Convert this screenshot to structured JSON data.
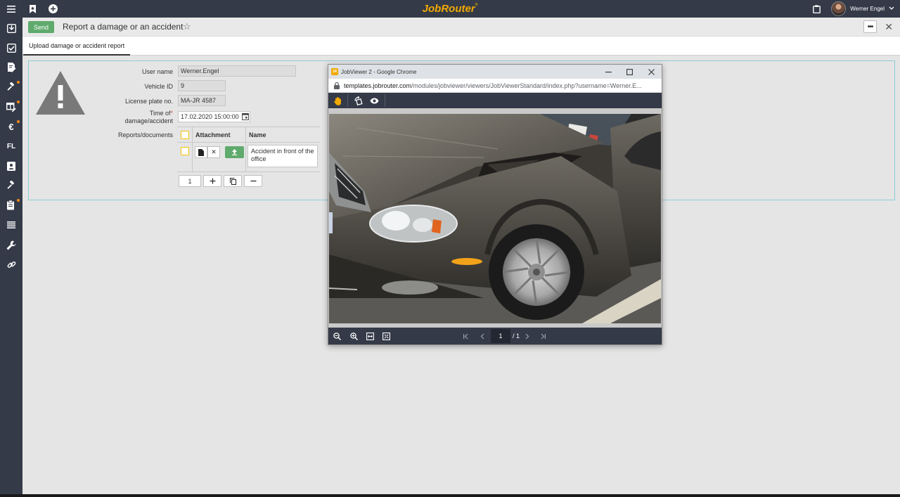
{
  "app": {
    "brand": "JobRouter",
    "brand_mark": "®"
  },
  "topbar": {
    "user_name": "Werner Engel"
  },
  "sidebar": {
    "items": [
      {
        "icon": "inbox-icon"
      },
      {
        "icon": "checkbox-icon"
      },
      {
        "icon": "document-edit-icon"
      },
      {
        "icon": "gavel-icon"
      },
      {
        "icon": "table-edit-icon"
      },
      {
        "icon": "euro-icon"
      },
      {
        "icon": "fl-text-icon",
        "text": "FL"
      },
      {
        "icon": "contact-card-icon"
      },
      {
        "icon": "gavel-icon"
      },
      {
        "icon": "clipboard-icon"
      },
      {
        "icon": "list-icon"
      },
      {
        "icon": "wrench-icon"
      },
      {
        "icon": "link-icon"
      }
    ]
  },
  "header": {
    "send_label": "Send",
    "title": "Report a damage or an accident",
    "more_label": "•••"
  },
  "tabs": [
    {
      "label": "Upload damage or accident report"
    }
  ],
  "form": {
    "user_name_label": "User name",
    "user_name_value": "Werner.Engel",
    "vehicle_id_label": "Vehicle ID",
    "vehicle_id_value": "9",
    "license_plate_label": "License plate no.",
    "license_plate_value": "MA-JR 4587",
    "time_label_line1": "Time of",
    "time_label_line2": "damage/accident",
    "time_required_mark": "*",
    "time_value": "17.02.2020 15:00:00",
    "reports_label": "Reports/documents",
    "grid": {
      "col_attachment": "Attachment",
      "col_name": "Name",
      "row_name_value": "Accident in front of the office",
      "row_count": "1"
    }
  },
  "popup": {
    "window_title": "JobViewer 2 - Google Chrome",
    "logo_text": "JR",
    "url_host": "templates.jobrouter.com",
    "url_path": "/modules/jobviewer/viewers/JobViewerStandard/index.php?username=Werner.E...",
    "page_current": "1",
    "page_total": "/ 1"
  },
  "colors": {
    "dark_bar": "#343a48",
    "brand": "#f2a900",
    "send_green": "#5faa6c",
    "panel_border": "#8fcdd6",
    "checkbox_yellow": "#f2c200"
  }
}
